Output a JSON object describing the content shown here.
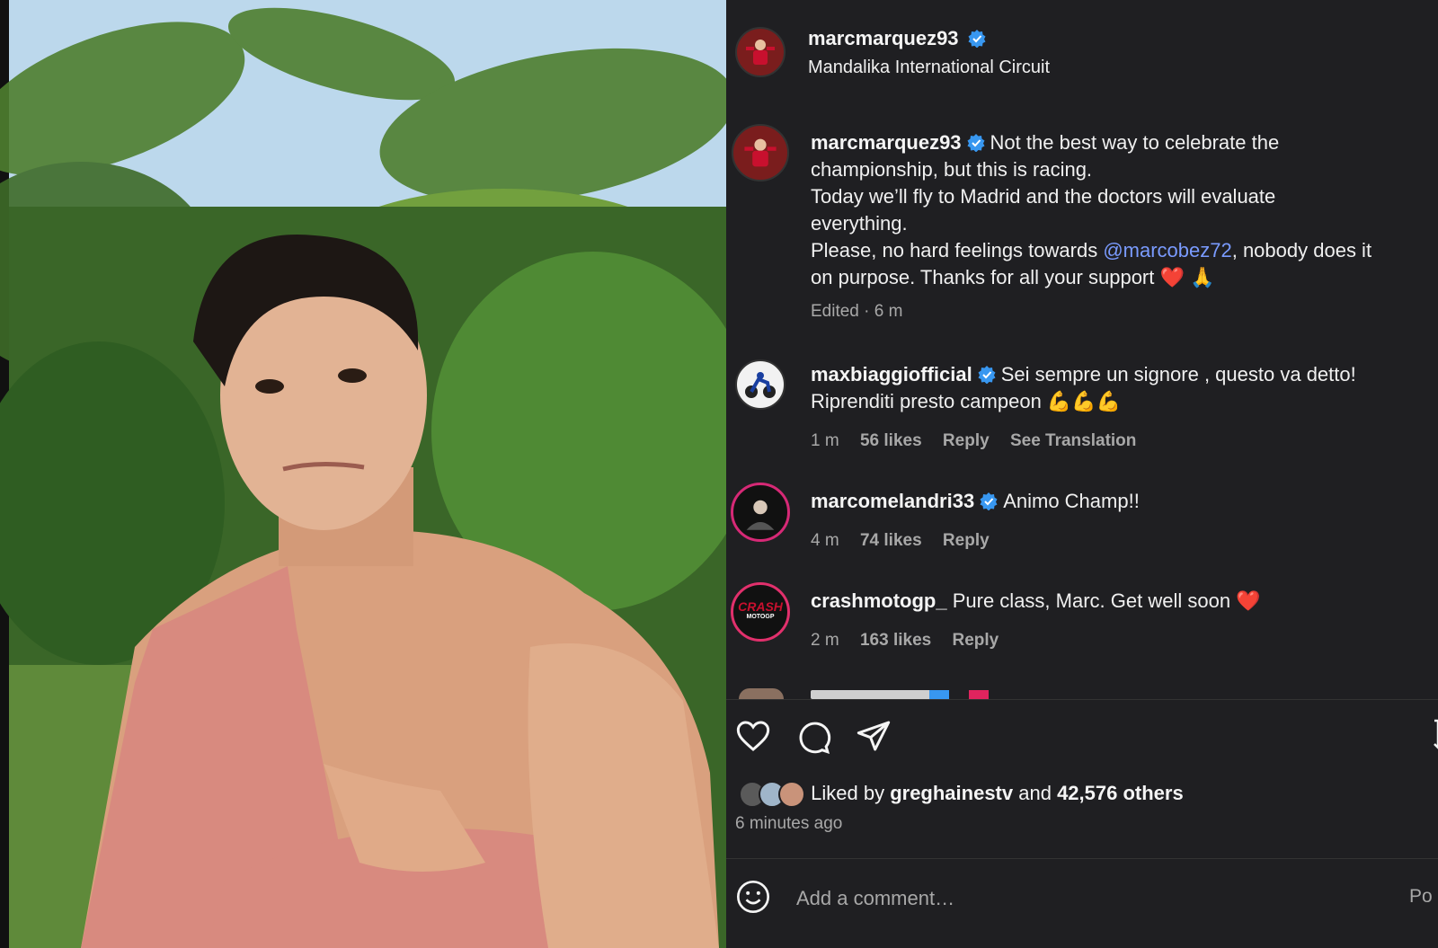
{
  "header": {
    "username": "marcmarquez93",
    "location": "Mandalika International Circuit"
  },
  "caption": {
    "username": "marcmarquez93",
    "line1": "Not the best way to celebrate the",
    "line2": "championship, but this is racing.",
    "line3": "Today we’ll fly to Madrid and the doctors will evaluate",
    "line4": "everything.",
    "line5_pre": "Please, no hard feelings towards ",
    "line5_mention": "@marcobez72",
    "line5_post": ", nobody does it",
    "line6": "on purpose. Thanks for all your support",
    "line6_emoji": "❤️ 🙏",
    "meta": "Edited · 6 m"
  },
  "comments": [
    {
      "username": "maxbiaggiofficial",
      "text1": "Sei sempre un signore , questo va detto!",
      "text2": "Riprenditi presto campeon 💪💪💪",
      "time": "1 m",
      "likes": "56 likes",
      "reply": "Reply",
      "translate": "See Translation"
    },
    {
      "username": "marcomelandri33",
      "text1": "Animo Champ!!",
      "time": "4 m",
      "likes": "74 likes",
      "reply": "Reply"
    },
    {
      "username": "crashmotogp_",
      "text1": "Pure class, Marc. Get well soon ❤️",
      "time": "2 m",
      "likes": "163 likes",
      "reply": "Reply",
      "avatar_text1": "CRASH",
      "avatar_text2": "MOTOGP"
    }
  ],
  "likes": {
    "pre": "Liked by ",
    "user": "greghainestv",
    "mid": " and ",
    "count": "42,576 others",
    "time": "6 minutes ago"
  },
  "add_comment": {
    "placeholder": "Add a comment…",
    "post_label": "Po"
  },
  "colors": {
    "panel_bg": "#1f1f22",
    "verified": "#3897f0",
    "mention": "#7a9bff",
    "crash_red": "#c8102e"
  },
  "icons": [
    "heart-icon",
    "comment-icon",
    "share-icon",
    "emoji-icon",
    "verified-icon"
  ]
}
